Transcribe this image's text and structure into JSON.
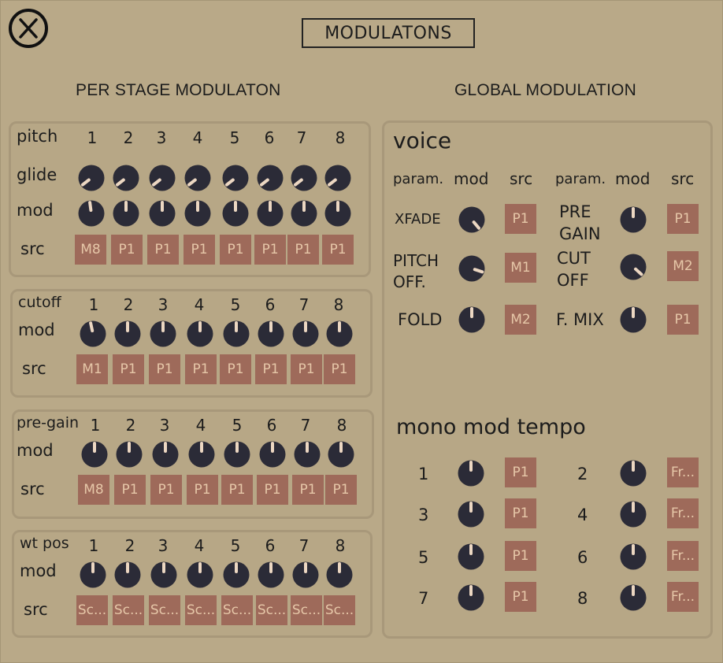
{
  "title": "MODULATONS",
  "per_stage": {
    "title": "PER STAGE MODULATON",
    "cols": [
      "1",
      "2",
      "3",
      "4",
      "5",
      "6",
      "7",
      "8"
    ],
    "pitch": {
      "label": "pitch",
      "glide_label": "glide",
      "mod_label": "mod",
      "src_label": "src",
      "src": [
        "M8",
        "P1",
        "P1",
        "P1",
        "P1",
        "P1",
        "P1",
        "P1"
      ]
    },
    "cutoff": {
      "label": "cutoff",
      "mod_label": "mod",
      "src_label": "src",
      "src": [
        "M1",
        "P1",
        "P1",
        "P1",
        "P1",
        "P1",
        "P1",
        "P1"
      ]
    },
    "pregain": {
      "label": "pre-gain",
      "mod_label": "mod",
      "src_label": "src",
      "src": [
        "M8",
        "P1",
        "P1",
        "P1",
        "P1",
        "P1",
        "P1",
        "P1"
      ]
    },
    "wtpos": {
      "label": "wt pos",
      "mod_label": "mod",
      "src_label": "src",
      "src": [
        "Sc...",
        "Sc...",
        "Sc...",
        "Sc...",
        "Sc...",
        "Sc...",
        "Sc...",
        "Sc..."
      ]
    }
  },
  "global": {
    "title": "GLOBAL MODULATION",
    "voice": {
      "title": "voice",
      "headers": [
        "param.",
        "mod",
        "src",
        "param.",
        "mod",
        "src"
      ],
      "rows": [
        {
          "p1": "XFADE",
          "s1": "P1",
          "p2a": "PRE",
          "p2b": "GAIN",
          "s2": "P1"
        },
        {
          "p1a": "PITCH",
          "p1b": "OFF.",
          "s1": "M1",
          "p2a": "CUT",
          "p2b": "OFF",
          "s2": "M2"
        },
        {
          "p1": "FOLD",
          "s1": "M2",
          "p2": "F. MIX",
          "s2": "P1"
        }
      ]
    },
    "mono": {
      "title": "mono mod tempo",
      "items": [
        {
          "num": "1",
          "src": "P1"
        },
        {
          "num": "2",
          "src": "Fr..."
        },
        {
          "num": "3",
          "src": "P1"
        },
        {
          "num": "4",
          "src": "Fr..."
        },
        {
          "num": "5",
          "src": "P1"
        },
        {
          "num": "6",
          "src": "Fr..."
        },
        {
          "num": "7",
          "src": "P1"
        },
        {
          "num": "8",
          "src": "Fr..."
        }
      ]
    }
  },
  "colors": {
    "background": "#b9a988",
    "knob": "#2b2b37",
    "knob_indicator": "#ecd7c2",
    "src_button": "#9e6a5a",
    "src_text": "#e6c7a8"
  }
}
